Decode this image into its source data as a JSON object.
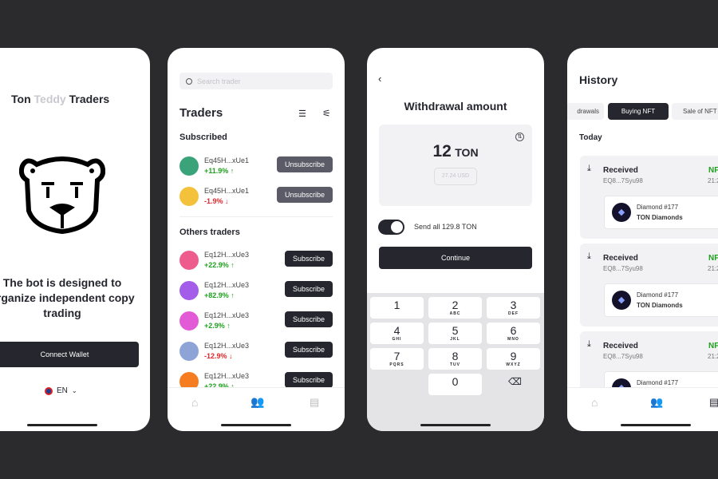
{
  "welcome": {
    "title_part1": "Ton",
    "title_part2": "Teddy",
    "title_part3": "Traders",
    "logo": "teddy-bear-logo",
    "description": "The bot is designed to organize independent copy trading",
    "connect_label": "Connect Wallet",
    "language": "EN",
    "flag_icon": "uk-flag-icon"
  },
  "traders": {
    "search_placeholder": "Search trader",
    "title": "Traders",
    "subscribed_heading": "Subscribed",
    "others_heading": "Others traders",
    "subscribed": [
      {
        "name": "Eq45H...xUe1",
        "change": "+11.9% ↑",
        "trend": "up",
        "action": "Unsubscribe",
        "color": "#3aa37a"
      },
      {
        "name": "Eq45H...xUe1",
        "change": "-1.9% ↓",
        "trend": "down",
        "action": "Unsubscribe",
        "color": "#f3c23a"
      }
    ],
    "others": [
      {
        "name": "Eq12H...xUe3",
        "change": "+22.9% ↑",
        "trend": "up",
        "action": "Subscribe",
        "color": "#ee5c8e"
      },
      {
        "name": "Eq12H...xUe3",
        "change": "+82.9% ↑",
        "trend": "up",
        "action": "Subscribe",
        "color": "#a35de8"
      },
      {
        "name": "Eq12H...xUe3",
        "change": "+2.9% ↑",
        "trend": "up",
        "action": "Subscribe",
        "color": "#e25ad6"
      },
      {
        "name": "Eq12H...xUe3",
        "change": "-12.9% ↓",
        "trend": "down",
        "action": "Subscribe",
        "color": "#8ea3d6"
      },
      {
        "name": "Eq12H...xUe3",
        "change": "+22.9% ↑",
        "trend": "up",
        "action": "Subscribe",
        "color": "#f57c1f"
      }
    ]
  },
  "withdraw": {
    "title": "Withdrawal amount",
    "amount": "12",
    "currency": "TON",
    "usd": "27.24 USD",
    "send_all": "Send all 129.8 TON",
    "toggle_on": true,
    "continue_label": "Continue",
    "keys": [
      {
        "n": "1",
        "l": ""
      },
      {
        "n": "2",
        "l": "ABC"
      },
      {
        "n": "3",
        "l": "DEF"
      },
      {
        "n": "4",
        "l": "GHI"
      },
      {
        "n": "5",
        "l": "JKL"
      },
      {
        "n": "6",
        "l": "MNO"
      },
      {
        "n": "7",
        "l": "PQRS"
      },
      {
        "n": "8",
        "l": "TUV"
      },
      {
        "n": "9",
        "l": "WXYZ"
      },
      {
        "n": "0",
        "l": ""
      }
    ]
  },
  "history": {
    "title": "History",
    "tabs": [
      "drawals",
      "Buying NFT",
      "Sale of NFT"
    ],
    "active_tab": "Buying NFT",
    "section": "Today",
    "items": [
      {
        "type": "Received",
        "address": "EQ8...7Syu98",
        "tag": "NF",
        "time": "21:2",
        "nft_name": "Diamond #177",
        "collection": "TON Diamonds"
      },
      {
        "type": "Received",
        "address": "EQ8...7Syu98",
        "tag": "NF",
        "time": "21:2",
        "nft_name": "Diamond #177",
        "collection": "TON Diamonds"
      },
      {
        "type": "Received",
        "address": "EQ8...7Syu98",
        "tag": "NF",
        "time": "21:2",
        "nft_name": "Diamond #177",
        "collection": "TON Diamonds"
      }
    ]
  },
  "colors": {
    "background": "#2b2b2d",
    "button_dark": "#25262e",
    "unsubscribe": "#5a5b66",
    "positive": "#1fa01f",
    "negative": "#e0262b"
  }
}
